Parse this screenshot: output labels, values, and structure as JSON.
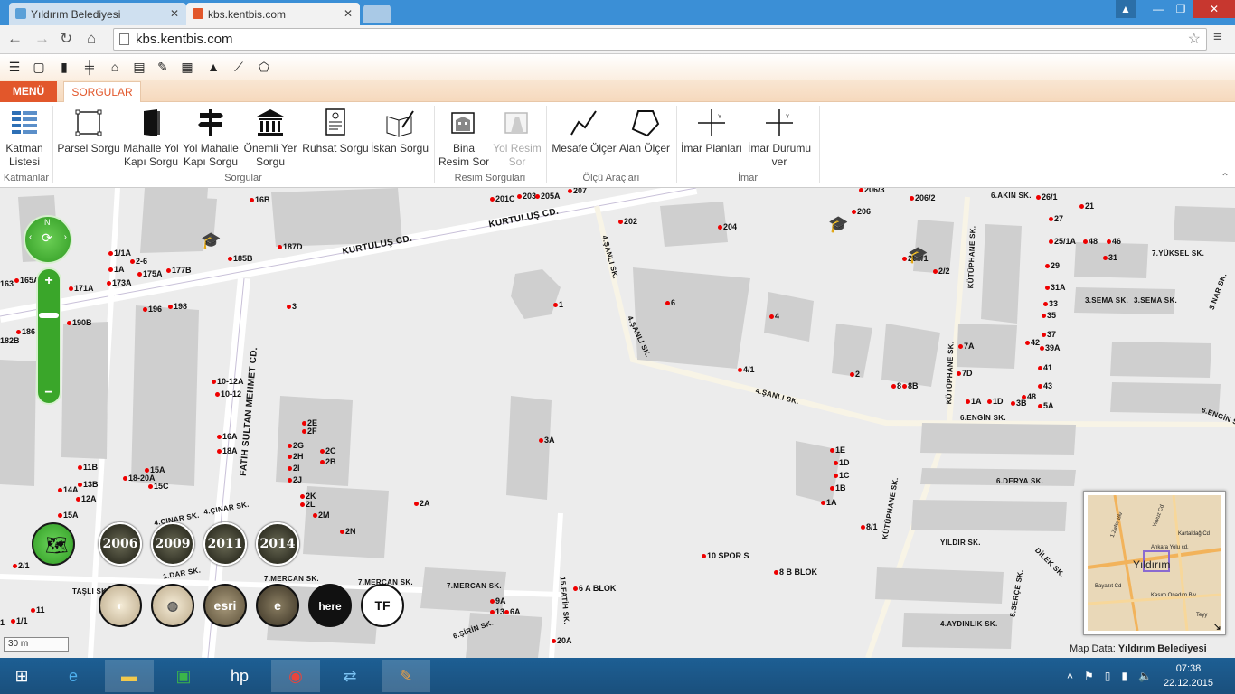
{
  "browser": {
    "tabs": [
      {
        "title": "Yıldırım Belediyesi",
        "active": false
      },
      {
        "title": "kbs.kentbis.com",
        "active": true
      }
    ],
    "url": "kbs.kentbis.com"
  },
  "app": {
    "menu_label": "MENÜ",
    "active_tab": "SORGULAR",
    "ribbon": {
      "buttons": [
        {
          "label": "Katman Listesi",
          "icon": "layers-icon"
        },
        {
          "label": "Parsel Sorgu",
          "icon": "parcel-icon"
        },
        {
          "label": "Mahalle Yol Kapı Sorgu",
          "icon": "door-icon"
        },
        {
          "label": "Yol Mahalle Kapı Sorgu",
          "icon": "signpost-icon"
        },
        {
          "label": "Önemli Yer Sorgu",
          "icon": "building-icon"
        },
        {
          "label": "Ruhsat Sorgu",
          "icon": "document-icon"
        },
        {
          "label": "İskan Sorgu",
          "icon": "book-pen-icon"
        },
        {
          "label": "Bina Resim Sor",
          "icon": "building-image-icon"
        },
        {
          "label": "Yol Resim Sor",
          "icon": "road-image-icon"
        },
        {
          "label": "Mesafe Ölçer",
          "icon": "distance-icon"
        },
        {
          "label": "Alan Ölçer",
          "icon": "area-icon"
        },
        {
          "label": "İmar Planları",
          "icon": "zoning-plan-icon"
        },
        {
          "label": "İmar Durumu ver",
          "icon": "zoning-status-icon"
        }
      ],
      "groups": [
        "Katmanlar",
        "Sorgular",
        "Resim Sorguları",
        "Ölçü Araçları",
        "İmar"
      ]
    }
  },
  "map": {
    "streets": [
      "KURTULUŞ CD.",
      "KURTULUŞ CD.",
      "FATİH SULTAN MEHMET CD.",
      "4.ŞANLI SK.",
      "4.ŞANLI SK.",
      "4.ŞANLI SK.",
      "KÜTÜPHANE SK.",
      "KÜTÜPHANE SK.",
      "KÜTÜPHANE SK.",
      "6.AKIN SK.",
      "7.YÜKSEL SK.",
      "6.ENGİN SK.",
      "6.DERYA SK.",
      "YILDIR SK.",
      "7.MERCAN SK.",
      "7.MERCAN SK.",
      "7.MERCAN SK.",
      "1.DAR SK.",
      "4.ÇINAR SK.",
      "4.ÇINAR SK.",
      "3.SEMA SK.",
      "3.SEMA SK.",
      "3.NAR SK.",
      "6.ENGİN S",
      "DİLEK SK.",
      "5.SERÇE SK.",
      "4.AYDINLIK SK.",
      "TAŞLI SK.",
      "6.ŞİRİN SK.",
      "15.FATİH SK."
    ],
    "labels": [
      "10 SPOR S",
      "8 B BLOK",
      "6 A BLOK",
      "3A",
      "202",
      "204",
      "206",
      "206/1",
      "206/2",
      "206/3",
      "201C",
      "203",
      "205A",
      "207",
      "185B",
      "187D",
      "175A",
      "177B",
      "190B",
      "196",
      "198",
      "10-12A",
      "10-12",
      "16A",
      "18A",
      "18-20A",
      "15A",
      "15C",
      "2E",
      "2F",
      "2G",
      "2H",
      "2I",
      "2J",
      "2C",
      "2B",
      "2K",
      "2L",
      "2M",
      "2N",
      "2A",
      "1E",
      "1D",
      "1C",
      "1B",
      "1A",
      "8/1",
      "4/1",
      "6",
      "4",
      "1",
      "3",
      "2",
      "8",
      "8B",
      "7A",
      "7D",
      "1A",
      "1D",
      "3B",
      "48",
      "5A",
      "43",
      "41",
      "42",
      "39A",
      "37",
      "35",
      "33",
      "31A",
      "29",
      "27",
      "25/1A",
      "48",
      "46",
      "31",
      "21",
      "26/1",
      "2/2",
      "1/1A",
      "1A",
      "173A",
      "171A",
      "165A",
      "163",
      "186",
      "182B",
      "11B",
      "13B",
      "14A",
      "15A",
      "16B",
      "2-6",
      "6A",
      "20A",
      "9A",
      "12A",
      "13",
      "11",
      "1/1",
      "2/1",
      "1",
      "2/1"
    ],
    "scale": "30 m",
    "attribution_prefix": "Map Data:",
    "attribution_source": "Yıldırım Belediyesi",
    "years": [
      "2006",
      "2009",
      "2011",
      "2014"
    ],
    "base_layers": [
      "osm",
      "bing",
      "esri",
      "ee",
      "here",
      "tf"
    ],
    "overview_labels": [
      "Yıldırım",
      "Ankara Yolu cd.",
      "Kasım Onadım Blv",
      "Bayazıt Cd",
      "Kartaldağ Cd",
      "1.Zafer Blv",
      "Yavuz Cd",
      "Teyy"
    ]
  },
  "taskbar": {
    "apps": [
      "start",
      "internet-explorer",
      "file-explorer",
      "store",
      "hp",
      "chrome",
      "teamviewer",
      "paint"
    ],
    "time": "07:38",
    "date": "22.12.2015"
  }
}
